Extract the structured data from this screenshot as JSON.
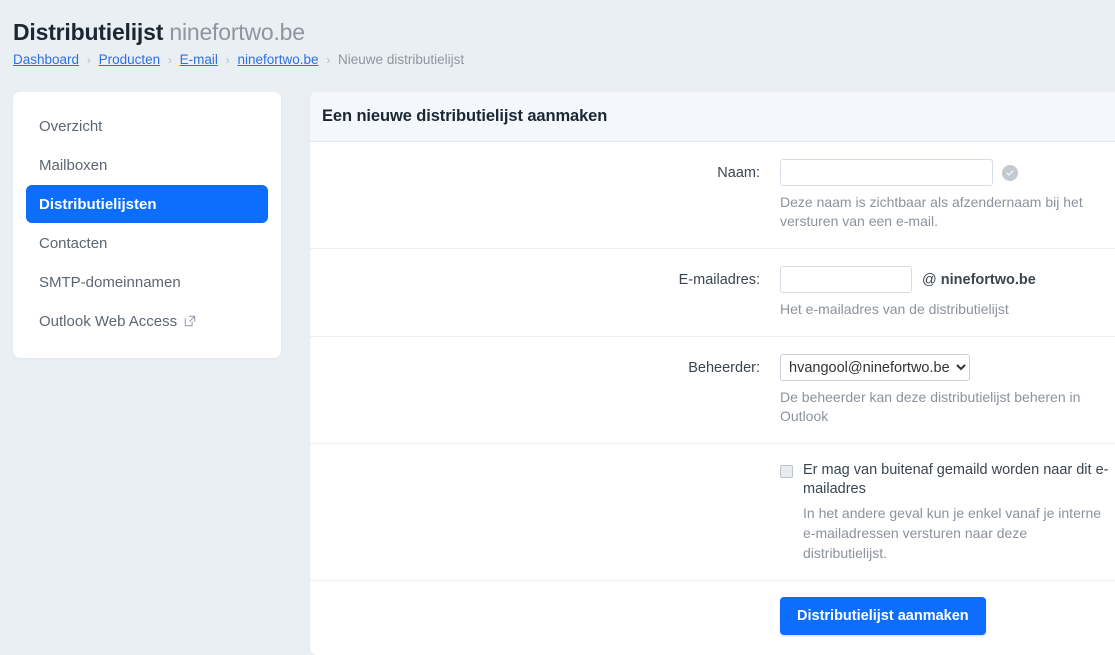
{
  "header": {
    "title_strong": "Distributielijst",
    "title_light": "ninefortwo.be",
    "breadcrumb": [
      {
        "label": "Dashboard",
        "link": true
      },
      {
        "label": "Producten",
        "link": true
      },
      {
        "label": "E-mail",
        "link": true
      },
      {
        "label": "ninefortwo.be",
        "link": true
      },
      {
        "label": "Nieuwe distributielijst",
        "link": false
      }
    ],
    "separator": "›"
  },
  "sidebar": {
    "items": [
      {
        "label": "Overzicht",
        "active": false
      },
      {
        "label": "Mailboxen",
        "active": false
      },
      {
        "label": "Distributielijsten",
        "active": true
      },
      {
        "label": "Contacten",
        "active": false
      },
      {
        "label": "SMTP-domeinnamen",
        "active": false
      },
      {
        "label": "Outlook Web Access",
        "active": false,
        "external": true
      }
    ]
  },
  "panel": {
    "title": "Een nieuwe distributielijst aanmaken",
    "fields": {
      "name": {
        "label": "Naam:",
        "value": "",
        "placeholder": "",
        "help": "Deze naam is zichtbaar als afzendernaam bij het versturen van een e-mail."
      },
      "email": {
        "label": "E-mailadres:",
        "value": "",
        "placeholder": "",
        "at": "@",
        "domain": "ninefortwo.be",
        "help": "Het e-mailadres van de distributielijst"
      },
      "admin": {
        "label": "Beheerder:",
        "selected": "hvangool@ninefortwo.be",
        "options": [
          "hvangool@ninefortwo.be"
        ],
        "help": "De beheerder kan deze distributielijst beheren in Outlook"
      },
      "external_mail": {
        "label": "Er mag van buitenaf gemaild worden naar dit e-mailadres",
        "checked": false,
        "help": "In het andere geval kun je enkel vanaf je interne e-mailadressen versturen naar deze distributielijst."
      }
    },
    "submit_label": "Distributielijst aanmaken"
  },
  "colors": {
    "accent": "#0d6efd",
    "page_background": "#eaeff4",
    "link": "#2f6fe4",
    "muted_text": "#8b939d"
  }
}
